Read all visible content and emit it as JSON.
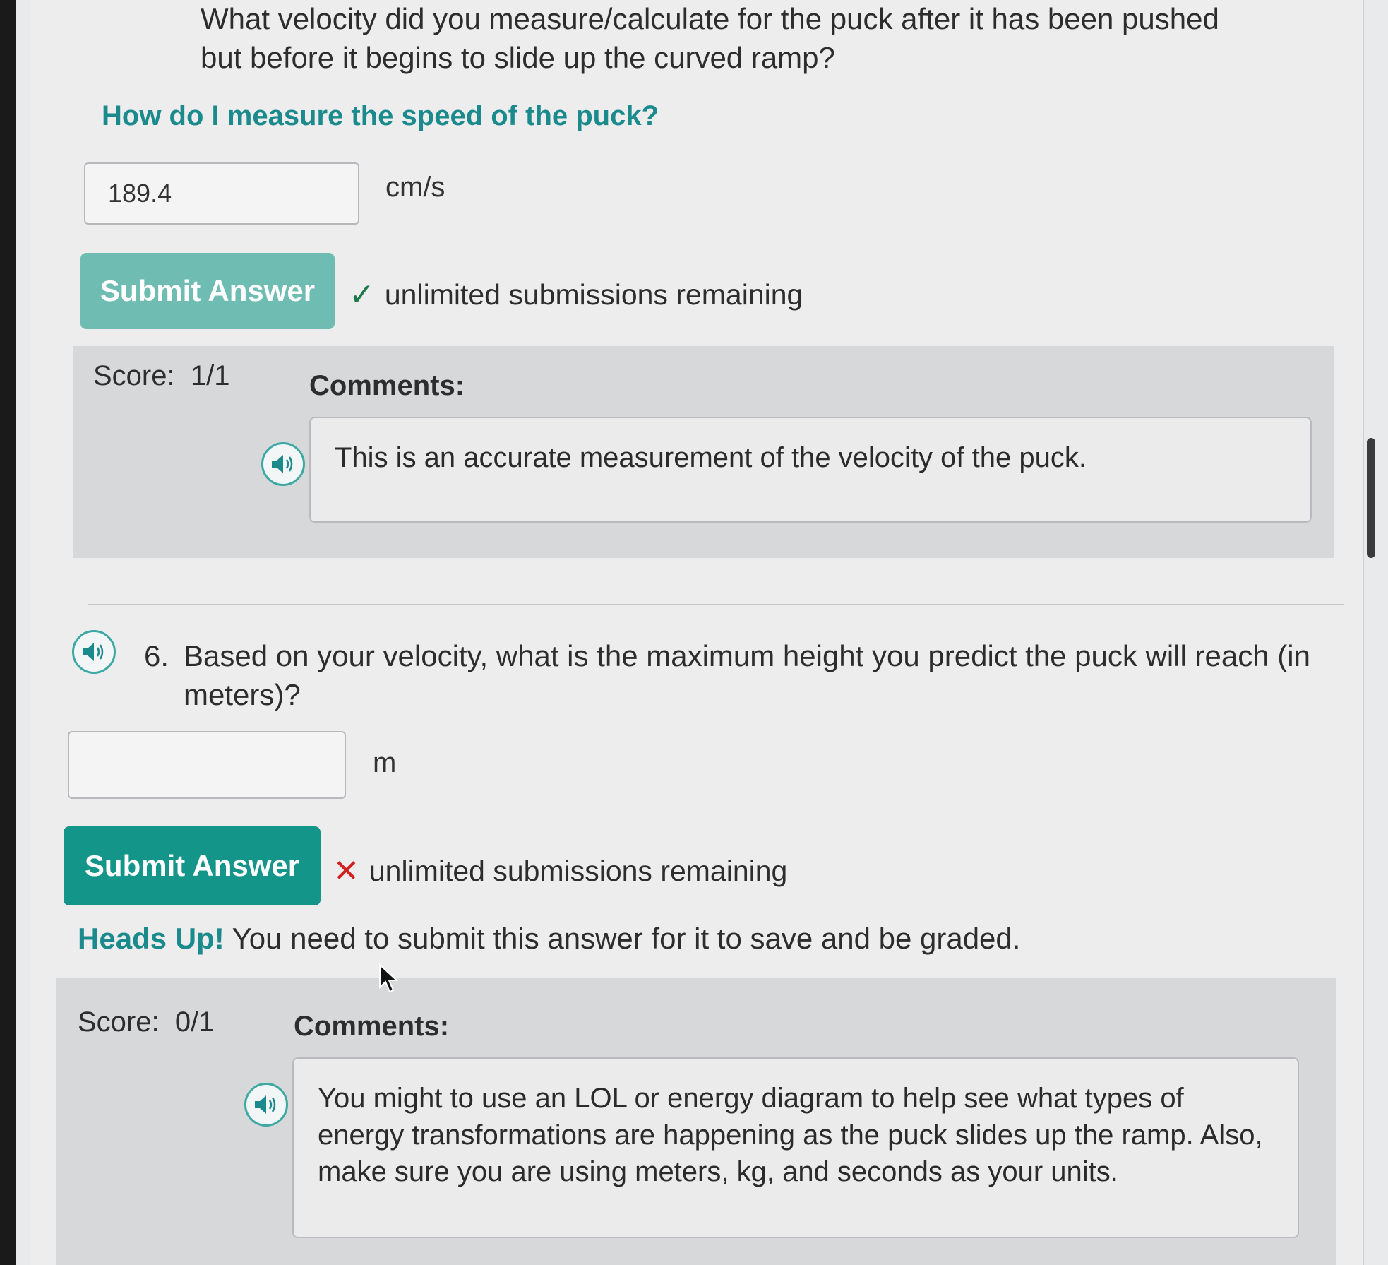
{
  "question5": {
    "text": "What velocity did you measure/calculate for the puck after it has been pushed but before it begins to slide up the curved ramp?",
    "help_link": "How do I measure the speed of the puck?",
    "answer_value": "189.4",
    "unit": "cm/s",
    "submit_label": "Submit Answer",
    "status_text": "unlimited submissions remaining",
    "score_label": "Score:",
    "score_value": "1/1",
    "comments_label": "Comments:",
    "comment": "This is an accurate measurement of the velocity of the puck."
  },
  "question6": {
    "number": "6.",
    "text": "Based on your velocity, what is the maximum height you predict the puck will reach (in meters)?",
    "answer_value": "",
    "unit": "m",
    "submit_label": "Submit Answer",
    "status_text": "unlimited submissions remaining",
    "heads_up_label": "Heads Up!",
    "heads_up_text": "You need to submit this answer for it to save and be graded.",
    "score_label": "Score:",
    "score_value": "0/1",
    "comments_label": "Comments:",
    "comment": "You might to use an LOL or energy diagram to help see what types of energy transformations are happening as the puck slides up the ramp. Also, make sure you are using meters, kg, and seconds as your units."
  },
  "icons": {
    "speaker": "speaker-icon",
    "check": "checkmark-icon",
    "cross": "cross-icon",
    "cursor": "mouse-cursor-icon"
  },
  "colors": {
    "accent": "#1b8a8c",
    "button_active": "#14958a",
    "button_faded": "#6fbcb3",
    "correct": "#1e7a48",
    "incorrect": "#d02020"
  }
}
